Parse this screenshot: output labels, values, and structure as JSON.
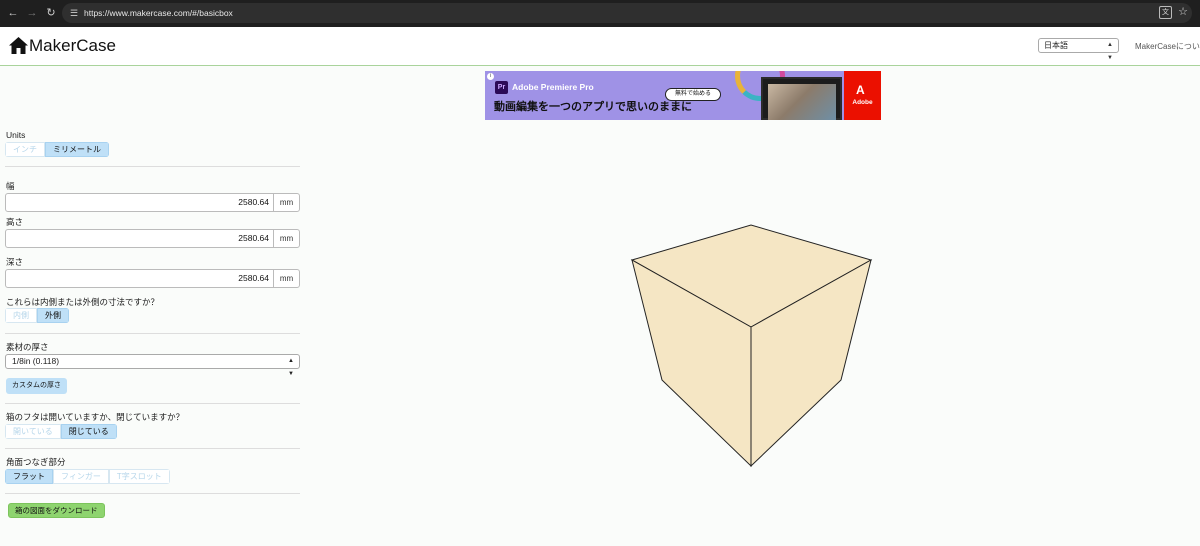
{
  "browser": {
    "url": "https://www.makercase.com/#/basicbox"
  },
  "header": {
    "logo_text": "MakerCase",
    "language": "日本語",
    "about": "MakerCaseについ"
  },
  "ad": {
    "product": "Adobe Premiere Pro",
    "product_badge": "Pr",
    "headline": "動画編集を一つのアプリで思いのままに",
    "cta": "無料で始める",
    "brand": "Adobe",
    "brand_color": "#eb1000",
    "background_color": "#9f92e6"
  },
  "panel": {
    "units": {
      "label": "Units",
      "options": [
        "インチ",
        "ミリメートル"
      ],
      "selected": "ミリメートル"
    },
    "width": {
      "label": "幅",
      "value": "2580.64",
      "unit": "mm"
    },
    "height": {
      "label": "高さ",
      "value": "2580.64",
      "unit": "mm"
    },
    "depth": {
      "label": "深さ",
      "value": "2580.64",
      "unit": "mm"
    },
    "dimension_type": {
      "label": "これらは内側または外側の寸法ですか？",
      "options": [
        "内側",
        "外側"
      ],
      "selected": "外側"
    },
    "material": {
      "label": "素材の厚さ",
      "value": "1/8in (0.118)",
      "custom_button": "カスタムの厚さ"
    },
    "lid": {
      "label": "箱のフタは開いていますか、閉じていますか？",
      "options": [
        "開いている",
        "閉じている"
      ],
      "selected": "閉じている"
    },
    "edge_joints": {
      "label": "角面つなぎ部分",
      "options": [
        "フラット",
        "フィンガー",
        "T字スロット"
      ],
      "selected": "フラット"
    },
    "download_button": "箱の図面をダウンロード"
  },
  "preview": {
    "face_color": "#f5e6c4",
    "edge_color": "#222222"
  }
}
